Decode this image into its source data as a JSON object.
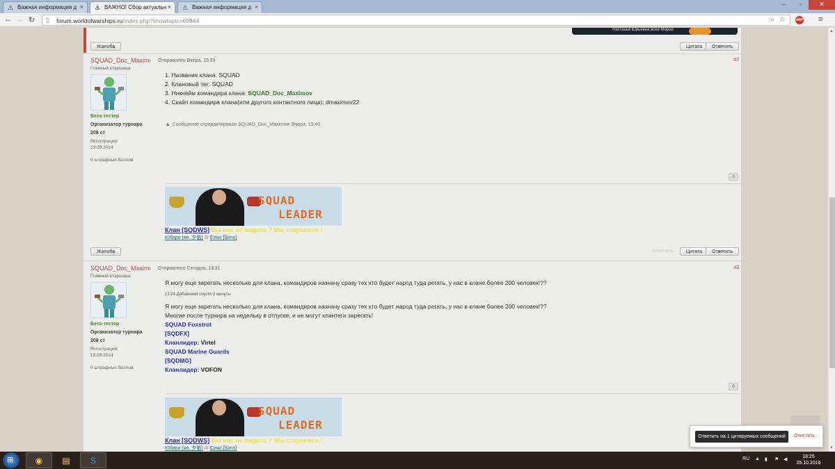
{
  "browser": {
    "tabs": [
      {
        "title": "Важная информация д",
        "active": false
      },
      {
        "title": "ВАЖНО! Сбор актуальн",
        "active": true
      },
      {
        "title": "Важная информация д",
        "active": false
      }
    ],
    "url_host": "forum.worldofwarships.ru",
    "url_path": "/index.php?showtopic=69644"
  },
  "banner_text": "Настасья Юрьевна всея Морей",
  "top_actions": {
    "report": "Жалоба",
    "quote": "Цитата",
    "reply": "Ответить"
  },
  "posts": [
    {
      "author": "SQUAD_Doc_Maximov",
      "title": "Главный старшина",
      "group": "Бета-тестер",
      "role": "Организатор турнира",
      "points": "208 ст",
      "reg_label": "Регистрация:",
      "reg_date": "13.09.2014",
      "penalty": "0 штрафных баллов",
      "sent": "Отправлено Вчера, 15:23",
      "number": "#2",
      "lines": [
        "1. Название клана. SQUAD",
        "2. Клановый тег: SQUAD",
        "3. Никнейм командира клана: ",
        "4. Скайп командира клана(или другого контактного лица): dmaximov22"
      ],
      "commander_link": "SQUAD_Doc_Maximov",
      "edit_note": "Сообщение отредактировал SQUAD_Doc_Maximov: Вчера, 15:40",
      "rep": "0",
      "edit_link": "Изменить",
      "report": "Жалоба",
      "quote": "Цитата",
      "reply": "Ответить"
    },
    {
      "author": "SQUAD_Doc_Maximov",
      "title": "Главный старшина",
      "group": "Бета-тестер",
      "role": "Организатор турнира",
      "points": "208 ст",
      "reg_label": "Регистрация:",
      "reg_date": "13.09.2014",
      "penalty": "0 штрафных баллов",
      "sent": "Отправлено Сегодня, 13:21",
      "number": "#3",
      "line1": "Я могу еще зарегать несколько для клана, командиров назначу сразу тех кто будет народ туда регать, у нас в клане более 200 человек!??",
      "added_note": "13:24 Добавлено спустя 2 минуты",
      "line2": "Я могу еще зарегать несколько для клана, командиров назначу сразу тех кто будет народ туда регать, у нас в клане более 200 человек!??",
      "line3": "Многие после турнира на недельку в отпуске, и не могут клантеги зарегать!",
      "clans": [
        {
          "name": "SQUAD Foxstrot",
          "tag": "[SQDFX]",
          "leader_label": "Кланлидер:",
          "leader": "Virtel"
        },
        {
          "name": "SQUAD Marine Guards",
          "tag": "[SQDMG]",
          "leader_label": "Кланлидер:",
          "leader": "VOFON"
        }
      ],
      "rep": "0"
    }
  ],
  "signature": {
    "banner_word1": "SQUAD",
    "banner_word2": "LEADER",
    "clan": "Клан [SQDWS]",
    "motto": " Вы нас не видите ? Мы стараемся !",
    "sub1": "Юбари (яп. 夕張)",
    "sep": "///",
    "sub2": "Симс [Sims]"
  },
  "multiquote": {
    "button": "Ответить на 1 цитируемых сообщений",
    "clear": "Очистить"
  },
  "taskbar": {
    "lang": "RU",
    "time": "18:25",
    "date": "25.10.2016"
  },
  "colors": {
    "author": "#b0524a",
    "group": "#4a8a2c",
    "clan_link": "#2233a4",
    "accent_red": "#c44a34"
  }
}
